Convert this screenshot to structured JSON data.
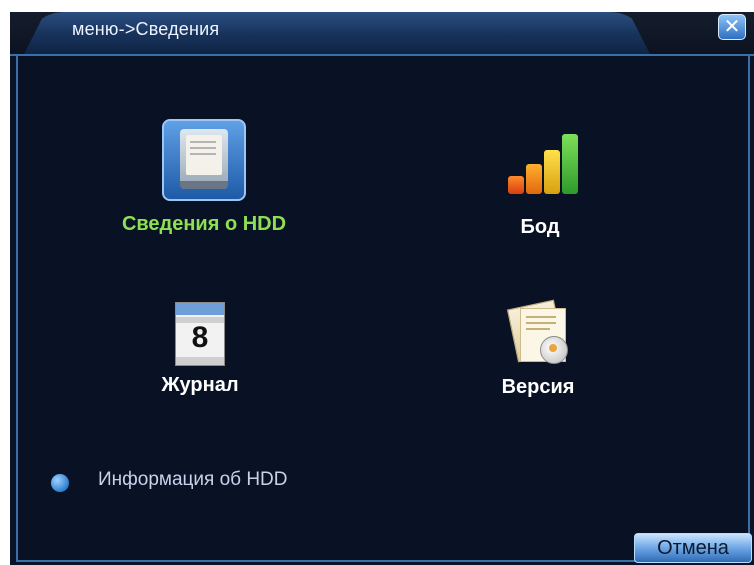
{
  "window": {
    "title": "меню->Сведения",
    "close_label": "✕"
  },
  "items": [
    {
      "label": "Сведения о HDD",
      "icon": "hdd-info-icon",
      "color": "#8de052"
    },
    {
      "label": "Бод",
      "icon": "bar-chart-icon",
      "color": "#ffffff"
    },
    {
      "label": "Журнал",
      "icon": "calendar-icon",
      "color": "#ffffff",
      "calendar_day": "8"
    },
    {
      "label": "Версия",
      "icon": "version-document-icon",
      "color": "#ffffff"
    }
  ],
  "status": {
    "hint_icon": "info-icon",
    "hint_text": "Информация об HDD"
  },
  "footer": {
    "cancel_label": "Отмена"
  },
  "colors": {
    "background": "#091225",
    "accent": "#3b6fa8",
    "selected_text": "#8de052"
  }
}
